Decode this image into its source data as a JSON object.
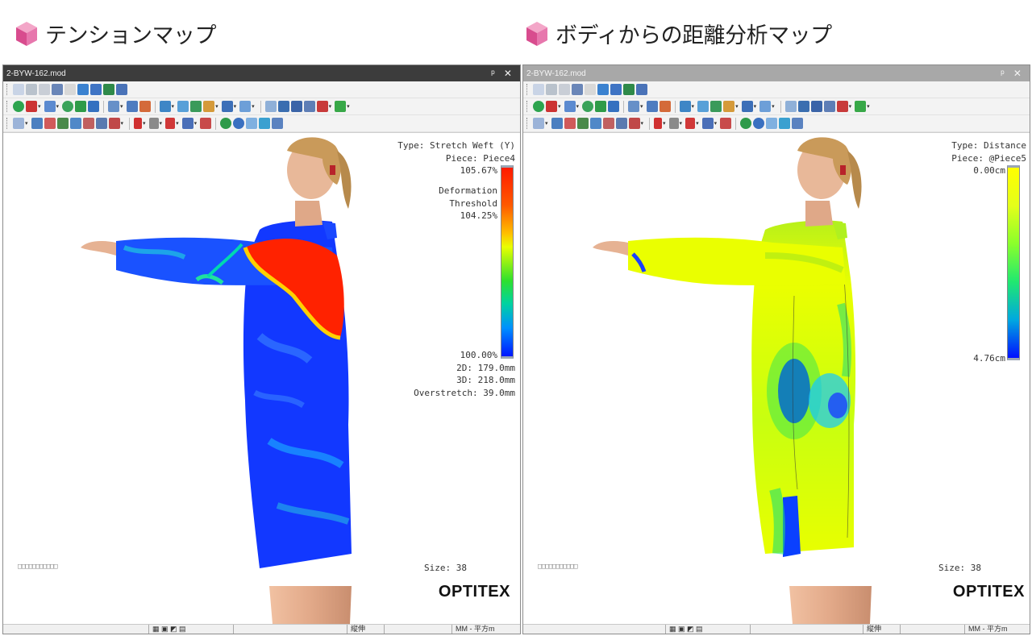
{
  "slide": {
    "left_heading": "テンションマップ",
    "right_heading": "ボディからの距離分析マップ",
    "cube_color": "#e0609c"
  },
  "left_panel": {
    "window_title": "2-BYW-162.mod",
    "controls": "ᵖ ✕",
    "info_top": [
      "Type: Stretch Weft (Y)",
      "Piece: Piece4",
      "105.67%"
    ],
    "info_mid": [
      "Deformation",
      "Threshold",
      "104.25%"
    ],
    "info_bottom": [
      "100.00%",
      "2D: 179.0mm",
      "3D: 218.0mm",
      "Overstretch: 39.0mm"
    ],
    "placeholder_boxes": "□□□□□□□□□□□",
    "size_label": "Size: 38",
    "logo": "OPTITEX",
    "status_unit_cell": "MM - 平方m",
    "status_mid_cell": "縦伸"
  },
  "right_panel": {
    "window_title": "2-BYW-162.mod",
    "controls": "ᵖ ✕",
    "info_top": [
      "Type: Distance",
      "Piece: @Piece5",
      "0.00cm"
    ],
    "info_bottom": [
      "4.76cm"
    ],
    "placeholder_boxes": "□□□□□□□□□□□",
    "size_label": "Size: 38",
    "logo": "OPTITEX",
    "status_mid_cell": "縦伸",
    "status_unit_cell": "MM - 平方m"
  },
  "colors": {
    "tension_high": "#ff2200",
    "tension_low": "#1430ff",
    "distance_near": "#f2ff00",
    "distance_far": "#0022ff",
    "skin": "#e7b596",
    "hair": "#c99a5a"
  },
  "icons": {
    "toolbar_row1": [
      "select-arrow-icon",
      "grid-icon",
      "grid-small-icon",
      "copy-icon",
      "cross-icon",
      "pointer-icon",
      "edit-icon",
      "book-icon",
      "table-icon"
    ],
    "toolbar_row2": [
      "recycle-icon",
      "close-red-icon",
      "window-icon",
      "refresh-icon",
      "download-arrow-icon",
      "play-icon",
      "frame-icon",
      "grid-select-icon",
      "paint-icon",
      "chart-icon",
      "zoom-icon",
      "image-icon",
      "person-icon",
      "monitor-icon",
      "picture-icon",
      "magnify-icon",
      "notebook-icon",
      "table-grid-icon",
      "film-icon",
      "shirt-icon"
    ],
    "toolbar_row3": [
      "crosshair-icon",
      "grid-view-icon",
      "camera-icon",
      "cube-icon",
      "globe-icon",
      "layer-icon",
      "pattern-icon",
      "film-icon",
      "hook-icon",
      "brush-icon",
      "needle-icon",
      "texture-icon",
      "pin-icon",
      "sphere-icon",
      "color-icon",
      "check-icon",
      "landscape-icon",
      "grid-icon"
    ]
  }
}
